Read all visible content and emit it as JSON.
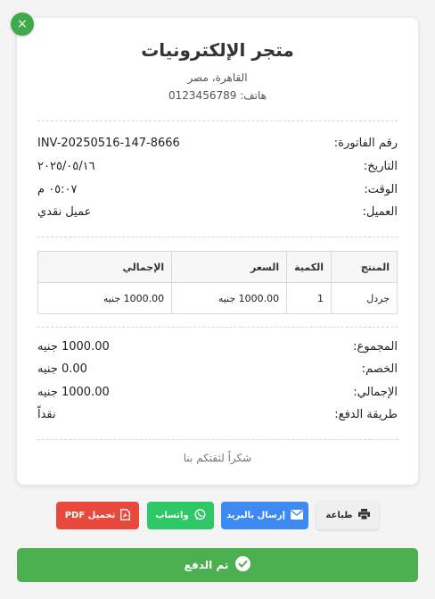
{
  "store": {
    "name": "متجر الإلكترونيات",
    "address": "القاهرة، مصر",
    "phone": "هاتف: 0123456789"
  },
  "invoice": {
    "number_label": "رقم الفاتورة:",
    "number_value": "INV-20250516-147-8666",
    "date_label": "التاريخ:",
    "date_value": "٢٠٢٥/٠٥/١٦",
    "time_label": "الوقت:",
    "time_value": "٠٥:٠٧ م",
    "customer_label": "العميل:",
    "customer_value": "عميل نقدي"
  },
  "table": {
    "headers": [
      "المنتج",
      "الكمية",
      "السعر",
      "الإجمالي"
    ],
    "rows": [
      [
        "جردل",
        "1",
        "1000.00 جنيه",
        "1000.00 جنيه"
      ]
    ]
  },
  "totals": {
    "subtotal_label": "المجموع:",
    "subtotal_value": "1000.00 جنيه",
    "discount_label": "الخصم:",
    "discount_value": "0.00 جنيه",
    "total_label": "الإجمالي:",
    "total_value": "1000.00 جنيه",
    "payment_label": "طريقة الدفع:",
    "payment_value": "نقداً"
  },
  "footer": {
    "thanks": "شكراً لثقتكم بنا"
  },
  "actions": {
    "close": "×",
    "print": "طباعة",
    "email": "إرسال بالبريد",
    "whatsapp": "واتساب",
    "pdf": "تحميل PDF",
    "paid": "تم الدفع"
  },
  "colors": {
    "close": "#3faa4c",
    "email": "#3d8bf2",
    "whatsapp": "#2ec866",
    "pdf": "#e8493c",
    "paid": "#4caf50"
  },
  "icons": {
    "close": "close-icon",
    "print": "printer-icon",
    "email": "envelope-icon",
    "whatsapp": "whatsapp-icon",
    "pdf": "pdf-file-icon",
    "paid": "check-circle-icon"
  }
}
